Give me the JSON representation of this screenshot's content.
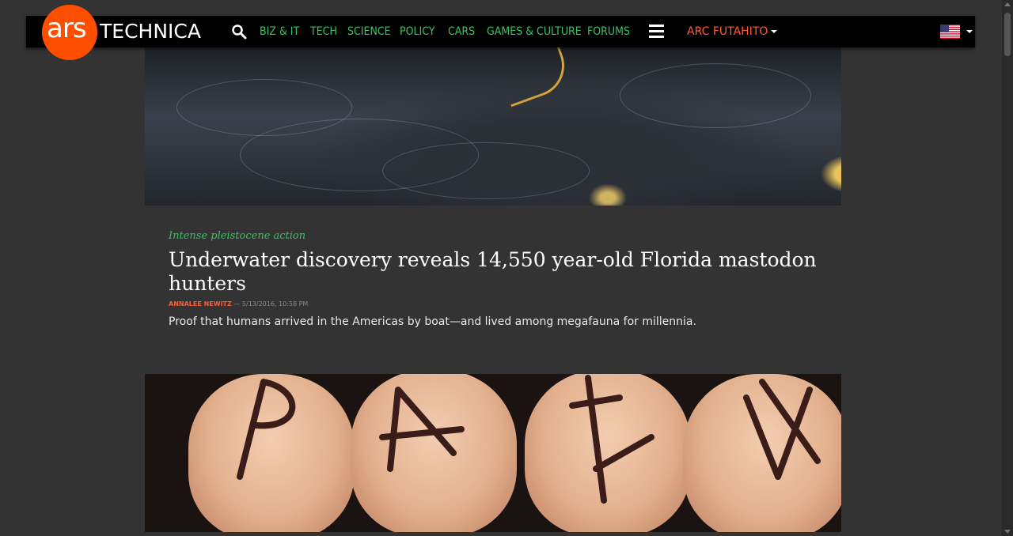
{
  "header": {
    "logo_ars": "ars",
    "logo_technica": "TECHNICA",
    "nav": [
      {
        "label": "BIZ & IT"
      },
      {
        "label": "TECH"
      },
      {
        "label": "SCIENCE"
      },
      {
        "label": "POLICY"
      },
      {
        "label": "CARS"
      },
      {
        "label": "GAMES & CULTURE"
      },
      {
        "label": "FORUMS"
      }
    ],
    "user_menu_label": "ARC FUTAHITO",
    "icons": {
      "search": "search-icon",
      "menu": "hamburger-menu-icon",
      "flag": "us-flag-icon"
    },
    "colors": {
      "nav_green": "#3ac163",
      "logo_orange": "#ff4e00",
      "user_orange": "#ff5c36"
    }
  },
  "articles": [
    {
      "kicker": "Intense pleistocene action",
      "headline": "Underwater discovery reveals 14,550 year-old Florida mastodon hunters",
      "author": "ANNALEE NEWITZ",
      "date": "5/13/2016, 10:58 PM",
      "separator": " — ",
      "excerpt": "Proof that humans arrived in the Americas by boat—and lived among megafauna for millennia."
    }
  ]
}
